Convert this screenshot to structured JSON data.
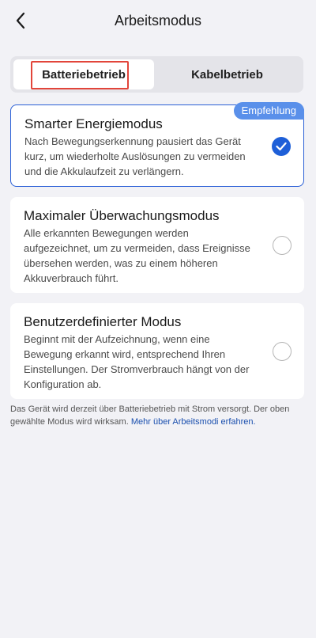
{
  "header": {
    "title": "Arbeitsmodus",
    "back_icon": "chevron-left-icon"
  },
  "segment": {
    "tabs": [
      {
        "label": "Batteriebetrieb",
        "active": true
      },
      {
        "label": "Kabelbetrieb",
        "active": false
      }
    ]
  },
  "modes": [
    {
      "title": "Smarter Energiemodus",
      "description": "Nach Bewegungserkennung pausiert das Gerät kurz, um wiederholte Auslösungen zu vermeiden und die Akkulaufzeit zu verlängern.",
      "badge": "Empfehlung",
      "selected": true
    },
    {
      "title": "Maximaler Überwachungsmodus",
      "description": "Alle erkannten Bewegungen werden aufgezeichnet, um zu vermeiden, dass Ereignisse übersehen werden, was zu einem höheren Akkuverbrauch führt.",
      "selected": false
    },
    {
      "title": "Benutzerdefinierter Modus",
      "description": "Beginnt mit der Aufzeichnung, wenn eine Bewegung erkannt wird, entsprechend Ihren Einstellungen. Der Stromverbrauch hängt von der Konfiguration ab.",
      "selected": false
    }
  ],
  "footer": {
    "text": "Das Gerät wird derzeit über Batteriebetrieb mit Strom versorgt. Der oben gewählte Modus wird wirksam. ",
    "link": "Mehr über Arbeitsmodi erfahren."
  },
  "colors": {
    "accent": "#1e5fd8",
    "badge": "#5a90ea",
    "highlight": "#e2453a",
    "background": "#f2f2f6"
  }
}
